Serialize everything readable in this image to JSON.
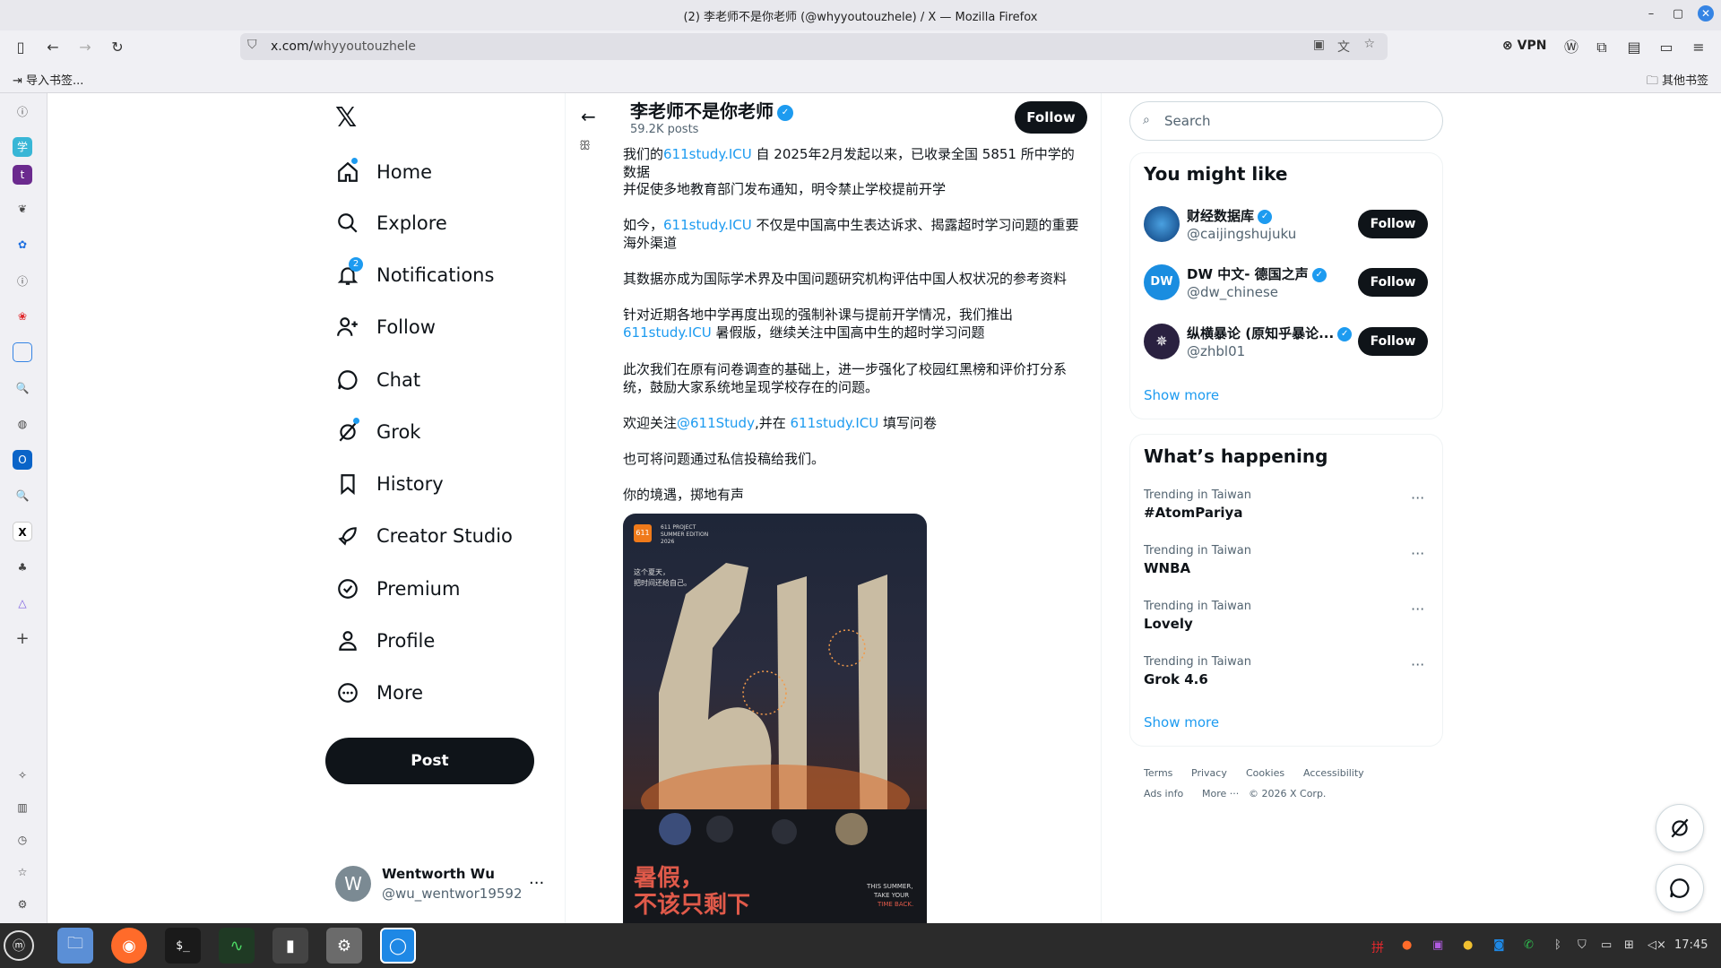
{
  "window": {
    "title": "(2) 李老师不是你老师 (@whyyoutouzhele) / X — Mozilla Firefox"
  },
  "browser": {
    "url_host": "x.com/",
    "url_path": "whyyoutouzhele",
    "vpn_label": "VPN",
    "bookmark_import": "导入书签...",
    "bookmark_other": "其他书签"
  },
  "xnav": {
    "items": [
      {
        "label": "Home"
      },
      {
        "label": "Explore"
      },
      {
        "label": "Notifications",
        "badge": "2"
      },
      {
        "label": "Follow"
      },
      {
        "label": "Chat"
      },
      {
        "label": "Grok"
      },
      {
        "label": "History"
      },
      {
        "label": "Creator Studio"
      },
      {
        "label": "Premium"
      },
      {
        "label": "Profile"
      },
      {
        "label": "More"
      }
    ],
    "post_label": "Post",
    "account": {
      "initial": "W",
      "name": "Wentworth Wu",
      "handle": "@wu_wentwor19592"
    }
  },
  "profile_header": {
    "name": "李老师不是你老师",
    "posts": "59.2K posts",
    "follow_label": "Follow"
  },
  "tweet": {
    "p1_pre": "我们的",
    "p1_link": "611study.ICU",
    "p1_post": " 自 2025年2月发起以来，已收录全国 5851 所中学的数据",
    "p2": "并促使多地教育部门发布通知，明令禁止学校提前开学",
    "p3_pre": "如今，",
    "p3_link": "611study.ICU",
    "p3_post": " 不仅是中国高中生表达诉求、揭露超时学习问题的重要海外渠道",
    "p4": "其数据亦成为国际学术界及中国问题研究机构评估中国人权状况的参考资料",
    "p5_a": "针对近期各地中学再度出现的强制补课与提前开学情况，我们推出",
    "p5_link": "611study.ICU",
    "p5_post": " 暑假版，继续关注中国高中生的超时学习问题",
    "p6": "此次我们在原有问卷调查的基础上，进一步强化了校园红黑榜和评价打分系统，鼓励大家系统地呈现学校存在的问题。",
    "p7_pre": "欢迎关注",
    "p7_link1": "@611Study",
    "p7_mid": ",并在 ",
    "p7_link2": "611study.ICU",
    "p7_post": " 填写问卷",
    "p8": "也可将问题通过私信投稿给我们。",
    "p9": "你的境遇，掷地有声",
    "poster": {
      "badge": "611",
      "project": "611 PROJECT\nSUMMER EDITION\n2026",
      "sub1": "这个夏天，",
      "sub2": "把时间还给自己。",
      "big": "611",
      "title1": "暑假，",
      "title2": "不该只剩下",
      "en1": "THIS SUMMER,",
      "en2": "TAKE YOUR",
      "en3": "TIME BACK."
    }
  },
  "right": {
    "search_placeholder": "Search",
    "you_might_like": "You might like",
    "suggestions": [
      {
        "name": "财经数据库",
        "handle": "@caijingshujuku",
        "follow": "Follow"
      },
      {
        "name": "DW 中文- 德国之声",
        "handle": "@dw_chinese",
        "follow": "Follow"
      },
      {
        "name": "纵横暴论 (原知乎暴论...",
        "handle": "@zhbl01",
        "follow": "Follow"
      }
    ],
    "show_more": "Show more",
    "whats_happening": "What’s happening",
    "trends": [
      {
        "context": "Trending in Taiwan",
        "name": "#AtomPariya"
      },
      {
        "context": "Trending in Taiwan",
        "name": "WNBA"
      },
      {
        "context": "Trending in Taiwan",
        "name": "Lovely"
      },
      {
        "context": "Trending in Taiwan",
        "name": "Grok 4.6"
      }
    ],
    "footer": [
      "Terms",
      "Privacy",
      "Cookies",
      "Accessibility",
      "Ads info",
      "More ···",
      "© 2026 X Corp."
    ]
  },
  "taskbar": {
    "clock": "17:45",
    "ime": "拼"
  },
  "colors": {
    "accent": "#1d9bf0",
    "text": "#0f1419",
    "muted": "#536471",
    "taskbar": "#2b2b2b"
  }
}
